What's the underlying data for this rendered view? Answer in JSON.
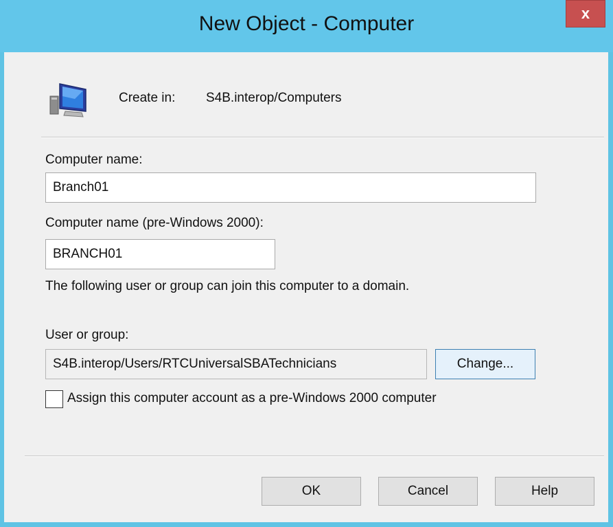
{
  "dialog": {
    "title": "New Object - Computer",
    "close_label": "x"
  },
  "header": {
    "icon": "computer-monitor-icon",
    "create_in_label": "Create in:",
    "create_in_path": "S4B.interop/Computers"
  },
  "form": {
    "computer_name_label": "Computer name:",
    "computer_name_value": "Branch01",
    "pre2000_label": "Computer name (pre-Windows 2000):",
    "pre2000_value": "BRANCH01",
    "join_info": "The following user or group can join this computer to a domain.",
    "user_group_label": "User or group:",
    "user_group_value": "S4B.interop/Users/RTCUniversalSBATechnicians",
    "change_button": "Change...",
    "assign_checkbox_label": "Assign this computer account as a pre-Windows 2000 computer",
    "assign_checked": false
  },
  "footer": {
    "ok_button": "OK",
    "cancel_button": "Cancel",
    "help_button": "Help"
  },
  "colors": {
    "titlebar": "#62c6ea",
    "close_button": "#c75050",
    "client_background": "#f0f0f0"
  }
}
